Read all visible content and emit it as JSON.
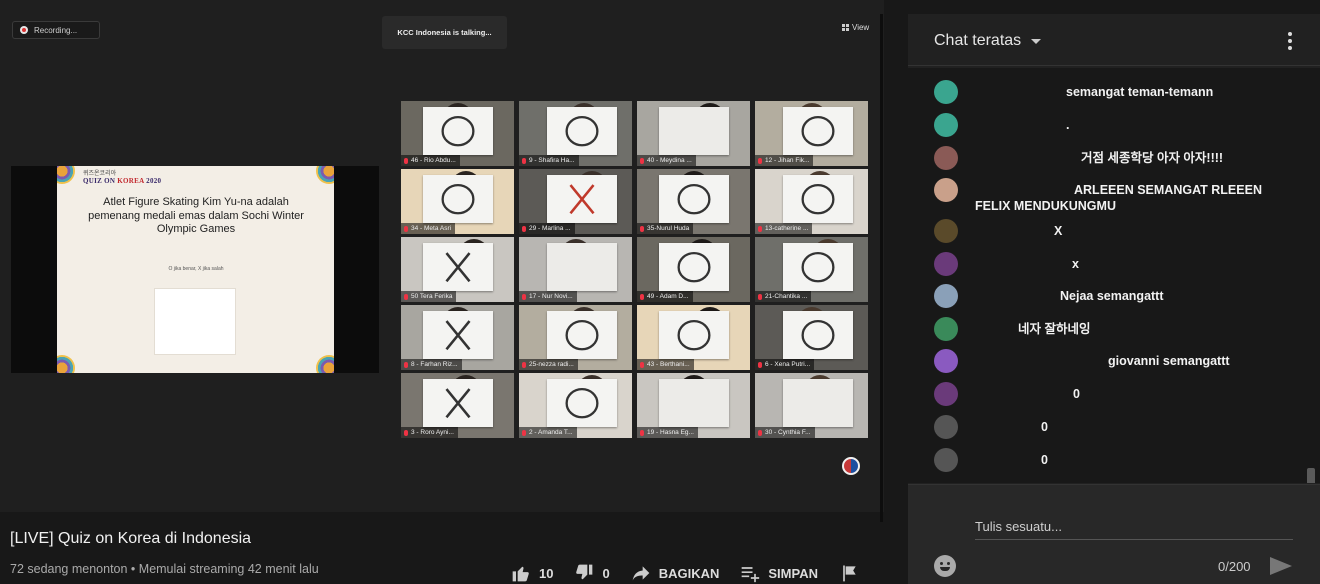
{
  "meeting": {
    "recording_label": "Recording...",
    "talking_label": "KCC Indonesia is talking...",
    "view_label": "View"
  },
  "slide": {
    "logo_small": "퀴즈온코리아",
    "logo_main_prefix": "QUIZ ON ",
    "logo_main_accent": "KOREA",
    "logo_main_year": " 2020",
    "question": "Atlet Figure Skating Kim Yu-na adalah pemenang medali emas dalam Sochi Winter Olympic Games",
    "hint": "O jika benar, X jika salah"
  },
  "participants": [
    {
      "name": "46 - Rio Abdu...",
      "mark": "O"
    },
    {
      "name": "9 - Shafira Ha...",
      "mark": "O"
    },
    {
      "name": "40 - Meydina ...",
      "mark": "blank"
    },
    {
      "name": "12 - Jihan Fik...",
      "mark": "O"
    },
    {
      "name": "34 - Meta Asri",
      "mark": "O"
    },
    {
      "name": "29 - Marlina ...",
      "mark": "X"
    },
    {
      "name": "35-Nurul Huda",
      "mark": "O"
    },
    {
      "name": "13-catherine ...",
      "mark": "O"
    },
    {
      "name": "50 Tera Ferika",
      "mark": "X"
    },
    {
      "name": "17 - Nur Novi...",
      "mark": "blank"
    },
    {
      "name": "49 - Adam D...",
      "mark": "O"
    },
    {
      "name": "21-Chantika ...",
      "mark": "O"
    },
    {
      "name": "8 - Farhan Riz...",
      "mark": "X"
    },
    {
      "name": "25-nezza radi...",
      "mark": "O"
    },
    {
      "name": "43 - Berthani...",
      "mark": "O"
    },
    {
      "name": "6 - Xena Putri...",
      "mark": "O"
    },
    {
      "name": "3 - Roro Ayni...",
      "mark": "X"
    },
    {
      "name": "2 - Amanda T...",
      "mark": "O"
    },
    {
      "name": "19 - Hasna Eg...",
      "mark": "blank"
    },
    {
      "name": "30 - Cynthia F...",
      "mark": "blank"
    }
  ],
  "video": {
    "title": "[LIVE] Quiz on Korea di Indonesia",
    "meta": "72 sedang menonton • Memulai streaming 42 menit lalu",
    "likes": "10",
    "dislikes": "0",
    "share_label": "BAGIKAN",
    "save_label": "SIMPAN"
  },
  "chat": {
    "header": "Chat teratas",
    "messages": [
      {
        "text": "semangat teman-temann",
        "avatar_color": "#3aa58f"
      },
      {
        "text": ".",
        "avatar_color": "#3aa58f"
      },
      {
        "text": "거점 세종학당 아자 아자!!!!",
        "avatar_color": "#8a5a56"
      },
      {
        "text": "ARLEEEN SEMANGAT RLEEEN",
        "text2": "FELIX MENDUKUNGMU",
        "avatar_color": "#c9a08a"
      },
      {
        "text": "X",
        "avatar_color": "#5a4a2a"
      },
      {
        "text": "x",
        "avatar_color": "#6a3a7a"
      },
      {
        "text": "Nejaa semangattt",
        "avatar_color": "#8aa0b8"
      },
      {
        "text": "네자 잘하네잉",
        "avatar_color": "#3a8a5a"
      },
      {
        "text": "giovanni semangattt",
        "avatar_color": "#8a5ac0"
      },
      {
        "text": "0",
        "avatar_color": "#6a3a7a"
      },
      {
        "text": "0",
        "avatar_color": "#555555"
      },
      {
        "text": "0",
        "avatar_color": "#555555"
      }
    ],
    "input_placeholder": "Tulis sesuatu...",
    "counter": "0/200"
  }
}
